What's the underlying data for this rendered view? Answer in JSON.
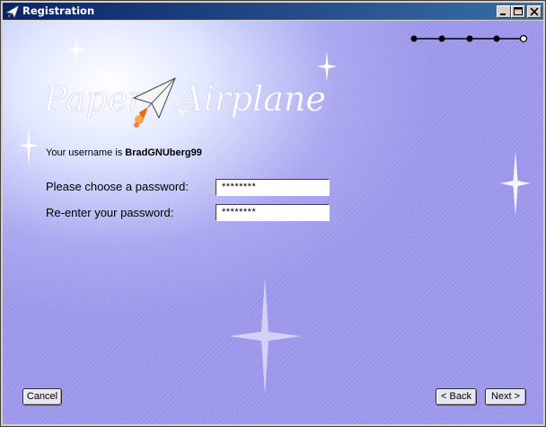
{
  "window": {
    "title": "Registration",
    "controls": [
      "minimize",
      "maximize",
      "close"
    ]
  },
  "logo": {
    "text_left": "Paper",
    "text_right": "Airplane",
    "icon": "paper-airplane-icon"
  },
  "progress": {
    "total_steps": 5,
    "current_step": 5
  },
  "form": {
    "username_prefix": "Your username is",
    "username": "BradGNUberg99",
    "password_label": "Please choose a password:",
    "password_value": "********",
    "reenter_label": "Re-enter your password:",
    "reenter_value": "********"
  },
  "buttons": {
    "cancel": "Cancel",
    "back": "< Back",
    "next": "Next >"
  },
  "colors": {
    "title_bar": "#0a246a",
    "background": "#9a95e8",
    "accent_orange": "#e86a1a"
  }
}
